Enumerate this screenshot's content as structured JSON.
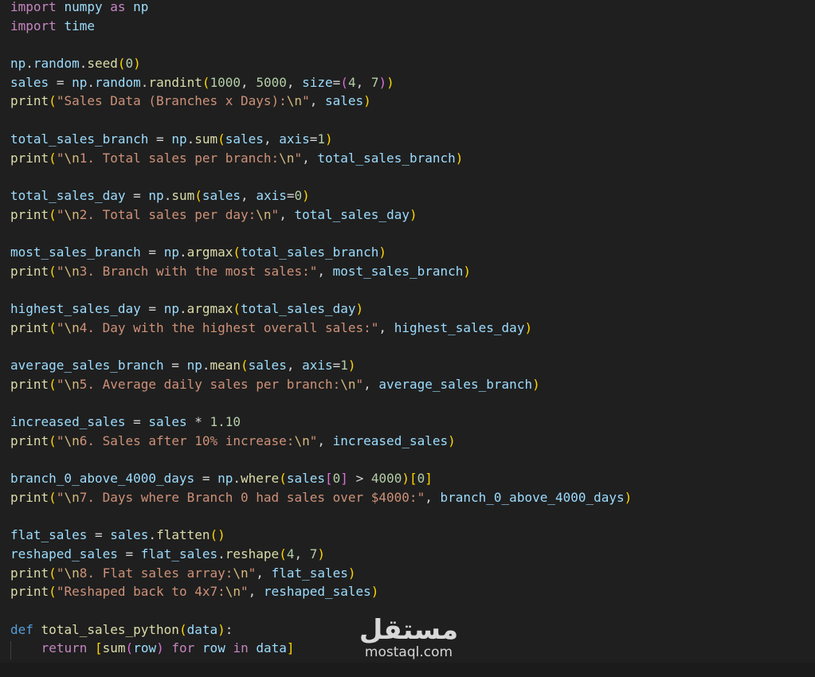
{
  "editor": {
    "language": "python",
    "lines": [
      "import numpy as np",
      "import time",
      "",
      "np.random.seed(0)",
      "sales = np.random.randint(1000, 5000, size=(4, 7))",
      "print(\"Sales Data (Branches x Days):\\n\", sales)",
      "",
      "total_sales_branch = np.sum(sales, axis=1)",
      "print(\"\\n1. Total sales per branch:\\n\", total_sales_branch)",
      "",
      "total_sales_day = np.sum(sales, axis=0)",
      "print(\"\\n2. Total sales per day:\\n\", total_sales_day)",
      "",
      "most_sales_branch = np.argmax(total_sales_branch)",
      "print(\"\\n3. Branch with the most sales:\", most_sales_branch)",
      "",
      "highest_sales_day = np.argmax(total_sales_day)",
      "print(\"\\n4. Day with the highest overall sales:\", highest_sales_day)",
      "",
      "average_sales_branch = np.mean(sales, axis=1)",
      "print(\"\\n5. Average daily sales per branch:\\n\", average_sales_branch)",
      "",
      "increased_sales = sales * 1.10",
      "print(\"\\n6. Sales after 10% increase:\\n\", increased_sales)",
      "",
      "branch_0_above_4000_days = np.where(sales[0] > 4000)[0]",
      "print(\"\\n7. Days where Branch 0 had sales over $4000:\", branch_0_above_4000_days)",
      "",
      "flat_sales = sales.flatten()",
      "reshaped_sales = flat_sales.reshape(4, 7)",
      "print(\"\\n8. Flat sales array:\\n\", flat_sales)",
      "print(\"Reshaped back to 4x7:\\n\", reshaped_sales)",
      "",
      "def total_sales_python(data):",
      "    return [sum(row) for row in data]"
    ]
  },
  "watermark": {
    "logo_text": "مستقل",
    "domain": "mostaql.com"
  },
  "colors": {
    "background": "#1f1f1f",
    "keyword": "#c586c0",
    "definition": "#569cd6",
    "variable": "#9cdcfe",
    "function": "#dcdcaa",
    "number": "#b5cea8",
    "string": "#ce9178",
    "escape": "#d7ba7d",
    "bracket_level_1": "#ffd700",
    "bracket_level_2": "#da70d6",
    "bracket_level_3": "#179fff"
  }
}
